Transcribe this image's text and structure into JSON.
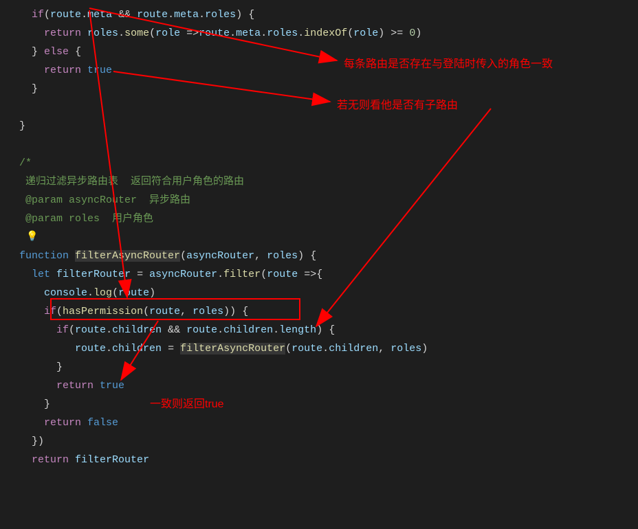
{
  "code": {
    "l1_if": "if",
    "l1_route1": "route",
    "l1_meta1": "meta",
    "l1_and": " && ",
    "l1_route2": "route",
    "l1_meta2": "meta",
    "l1_roles": "roles",
    "l2_return": "return",
    "l2_roles": "roles",
    "l2_some": "some",
    "l2_role": "role",
    "l2_arrow": " =>",
    "l2_route": "route",
    "l2_meta": "meta",
    "l2_rolesp": "roles",
    "l2_indexof": "indexOf",
    "l2_role2": "role",
    "l2_gte": " >= ",
    "l2_zero": "0",
    "l3_else": "else",
    "l4_return": "return",
    "l4_true": "true",
    "l8_open": "/*",
    "l9": " 递归过滤异步路由表  返回符合用户角色的路由",
    "l10": " @param asyncRouter  异步路由",
    "l11": " @param roles  用户角色",
    "l13_function": "function",
    "l13_name": "filterAsyncRouter",
    "l13_p1": "asyncRouter",
    "l13_p2": "roles",
    "l14_let": "let",
    "l14_var": "filterRouter",
    "l14_async": "asyncRouter",
    "l14_filter": "filter",
    "l14_route": "route",
    "l14_arrow": " =>",
    "l15_console": "console",
    "l15_log": "log",
    "l15_route": "route",
    "l16_if": "if",
    "l16_hasperm": "hasPermission",
    "l16_route": "route",
    "l16_roles": "roles",
    "l17_if": "if",
    "l17_route1": "route",
    "l17_children1": "children",
    "l17_and": " && ",
    "l17_route2": "route",
    "l17_children2": "children",
    "l17_length": "length",
    "l18_route1": "route",
    "l18_children1": "children",
    "l18_filterasync": "filterAsyncRouter",
    "l18_route2": "route",
    "l18_children2": "children",
    "l18_roles": "roles",
    "l20_return": "return",
    "l20_true": "true",
    "l22_return": "return",
    "l22_false": "false",
    "l24_return": "return",
    "l24_filterRouter": "filterRouter"
  },
  "annotations": {
    "a1": "每条路由是否存在与登陆时传入的角色一致",
    "a2": "若无则看他是否有子路由",
    "a3": "一致则返回true"
  }
}
